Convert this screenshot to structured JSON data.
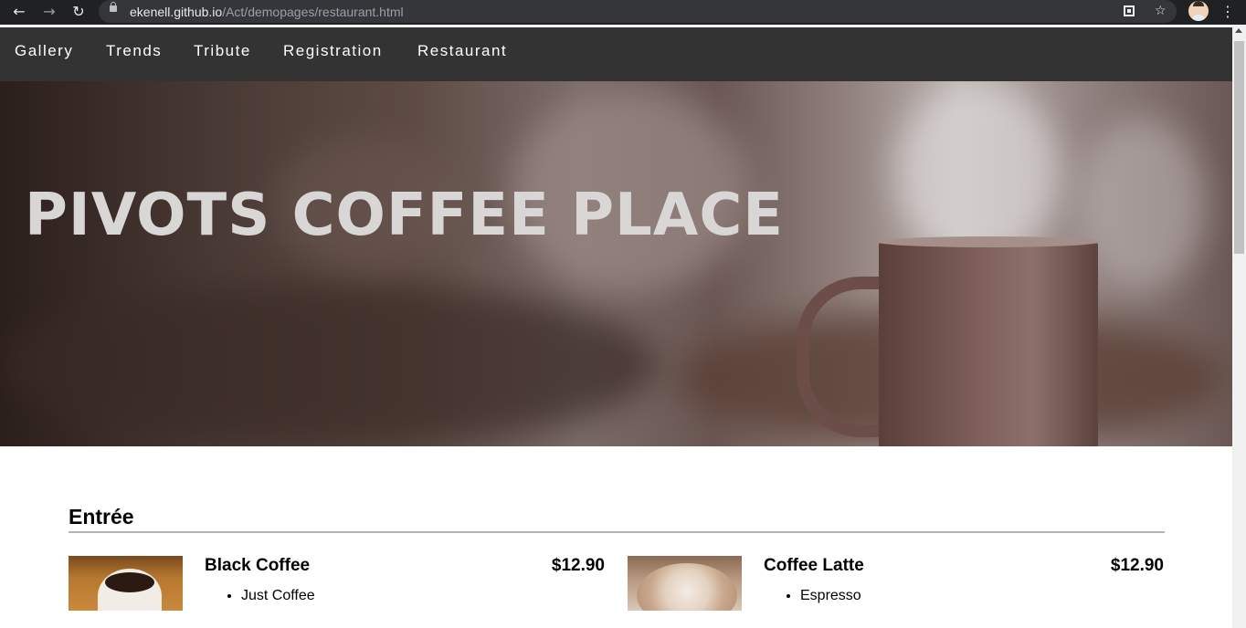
{
  "browser": {
    "url_host": "ekenell.github.io",
    "url_path": "/Act/demopages/restaurant.html",
    "icons": [
      "back-arrow-icon",
      "forward-arrow-icon",
      "reload-icon",
      "lock-icon",
      "qr-code-icon",
      "star-icon",
      "profile-avatar",
      "more-vert-icon"
    ]
  },
  "nav": {
    "items": [
      "Gallery",
      "Trends",
      "Tribute",
      "Registration",
      "Restaurant"
    ]
  },
  "hero": {
    "title": "PIVOTS COFFEE PLACE"
  },
  "menu": {
    "section_title": "Entrée",
    "items": [
      {
        "name": "Black Coffee",
        "price": "$12.90",
        "ingredients": [
          "Just Coffee"
        ]
      },
      {
        "name": "Coffee Latte",
        "price": "$12.90",
        "ingredients": [
          "Espresso"
        ]
      }
    ]
  }
}
